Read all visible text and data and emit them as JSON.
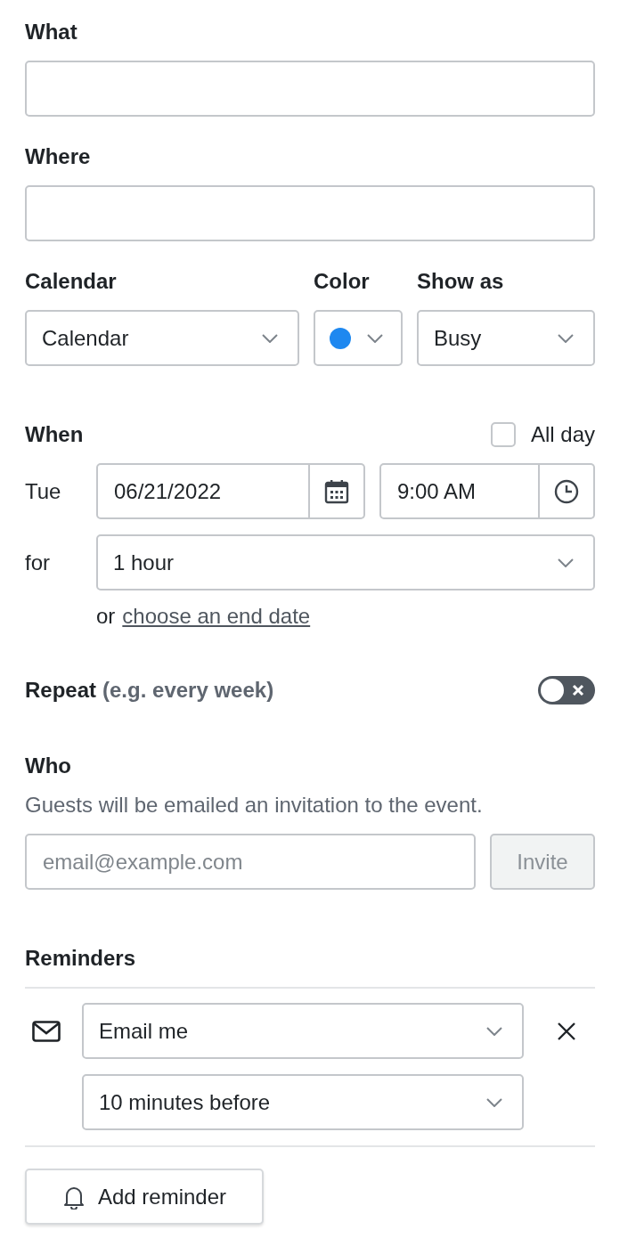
{
  "text_fields": [
    {
      "label": "What"
    },
    {
      "label": "Where"
    }
  ],
  "calendar_row": {
    "calendar": {
      "label": "Calendar",
      "value": "Calendar"
    },
    "color": {
      "label": "Color",
      "color": "#1e88f0"
    },
    "show_as": {
      "label": "Show as",
      "value": "Busy"
    }
  },
  "when": {
    "label": "When",
    "all_day": {
      "label": "All day",
      "checked": false
    },
    "day": "Tue",
    "date": "06/21/2022",
    "time": "9:00 AM",
    "duration_label": "for",
    "duration": "1 hour",
    "end_prefix": "or",
    "end_link": "choose an end date"
  },
  "repeat": {
    "label": "Repeat",
    "hint": "(e.g. every week)",
    "on": false
  },
  "who": {
    "label": "Who",
    "description": "Guests will be emailed an invitation to the event.",
    "email_placeholder": "email@example.com",
    "invite": {
      "label": "Invite",
      "disabled": true
    }
  },
  "reminders": {
    "label": "Reminders",
    "items": [
      {
        "method": "Email me",
        "time": "10 minutes before"
      }
    ],
    "add_button": "Add reminder"
  }
}
